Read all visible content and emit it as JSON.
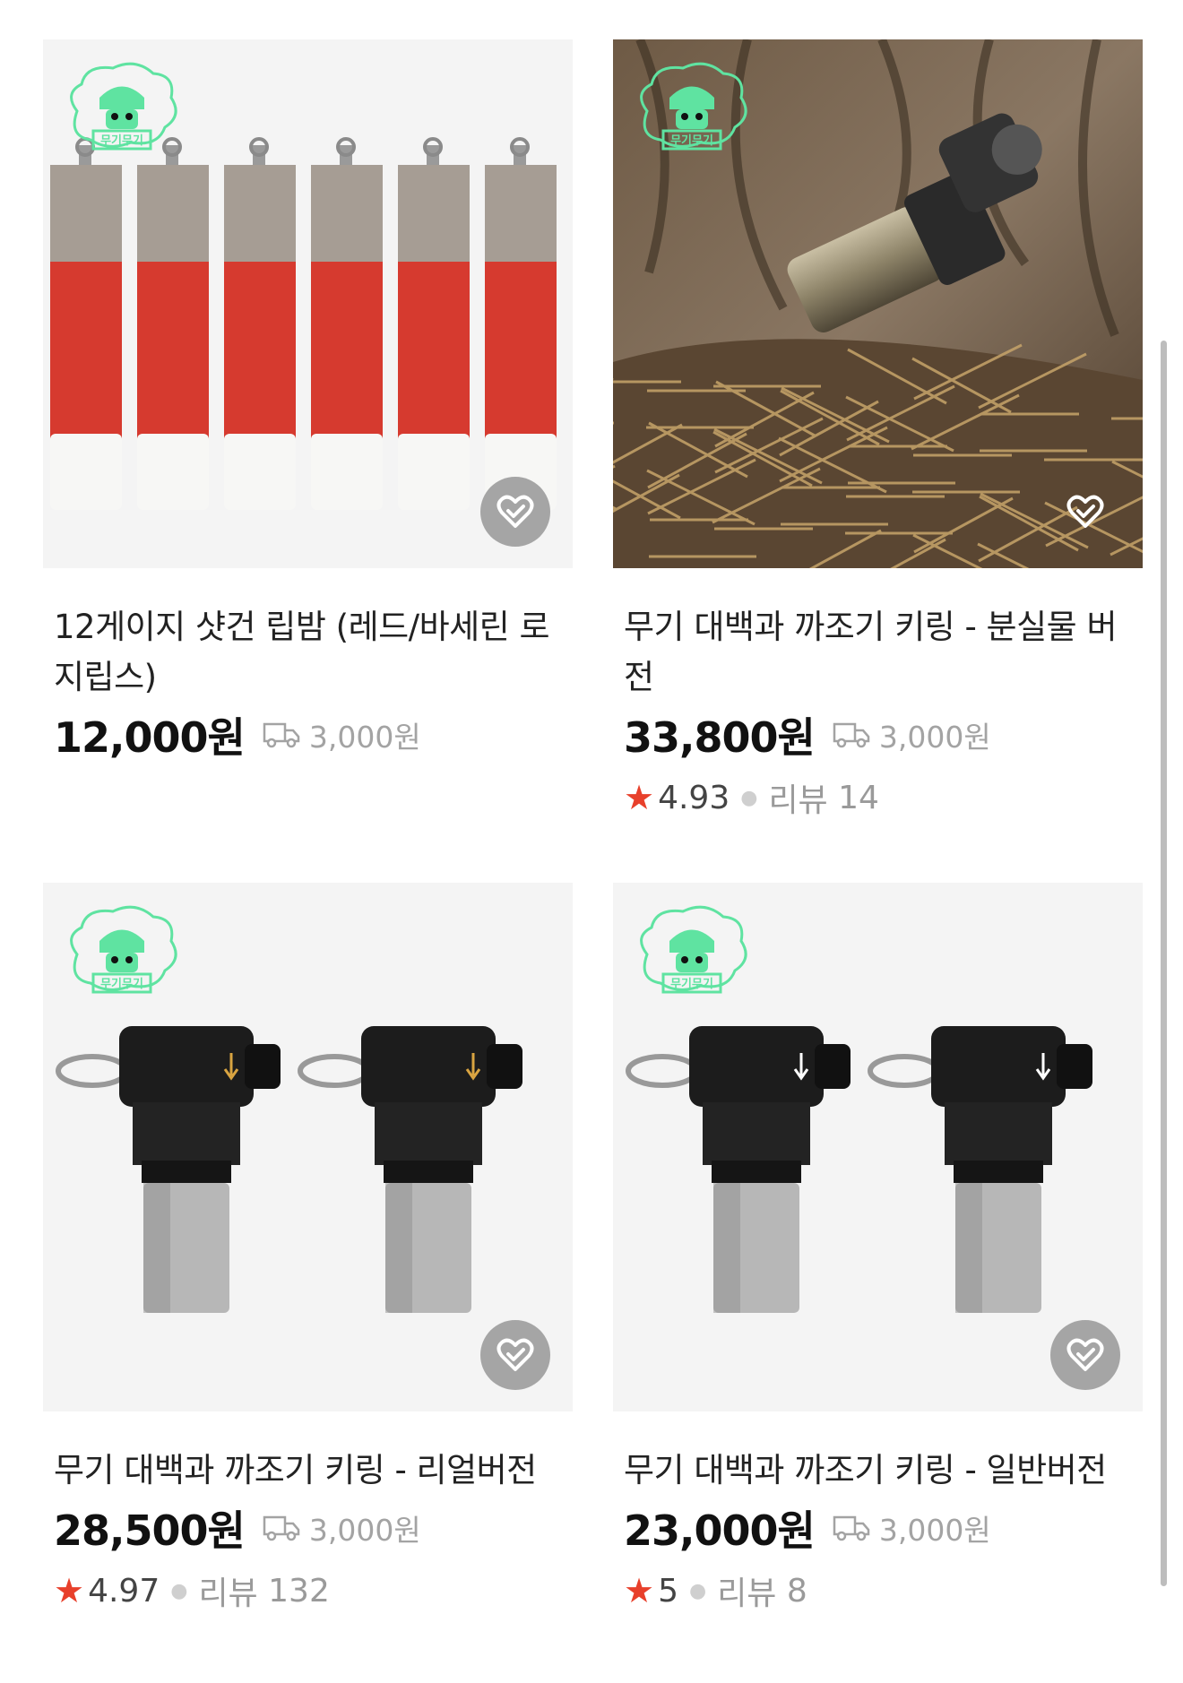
{
  "products": [
    {
      "title": "12게이지 샷건 립밤 (레드/바세린 로지립스)",
      "price": "12,000원",
      "shipping": "3,000원",
      "rating": null,
      "review_label": null,
      "review_count": null,
      "image": "shotgun-shell-lip-balms"
    },
    {
      "title": "무기 대백과 까조기 키링 - 분실물 버전",
      "price": "33,800원",
      "shipping": "3,000원",
      "rating": "4.93",
      "review_label": "리뷰",
      "review_count": "14",
      "image": "keyring-on-tree-bark"
    },
    {
      "title": "무기 대백과 까조기 키링 - 리얼버전",
      "price": "28,500원",
      "shipping": "3,000원",
      "rating": "4.97",
      "review_label": "리뷰",
      "review_count": "132",
      "image": "two-keyrings-gold-arrow"
    },
    {
      "title": "무기 대백과 까조기 키링 - 일반버전",
      "price": "23,000원",
      "shipping": "3,000원",
      "rating": "5",
      "review_label": "리뷰",
      "review_count": "8",
      "image": "two-keyrings-white-arrow"
    }
  ],
  "brand_logo_text": "무기무기",
  "icons": {
    "wishlist": "heart-check-icon",
    "shipping": "truck-icon",
    "rating": "star-icon"
  },
  "colors": {
    "accent_star": "#e8402b",
    "logo_green": "#5fe3a1"
  }
}
